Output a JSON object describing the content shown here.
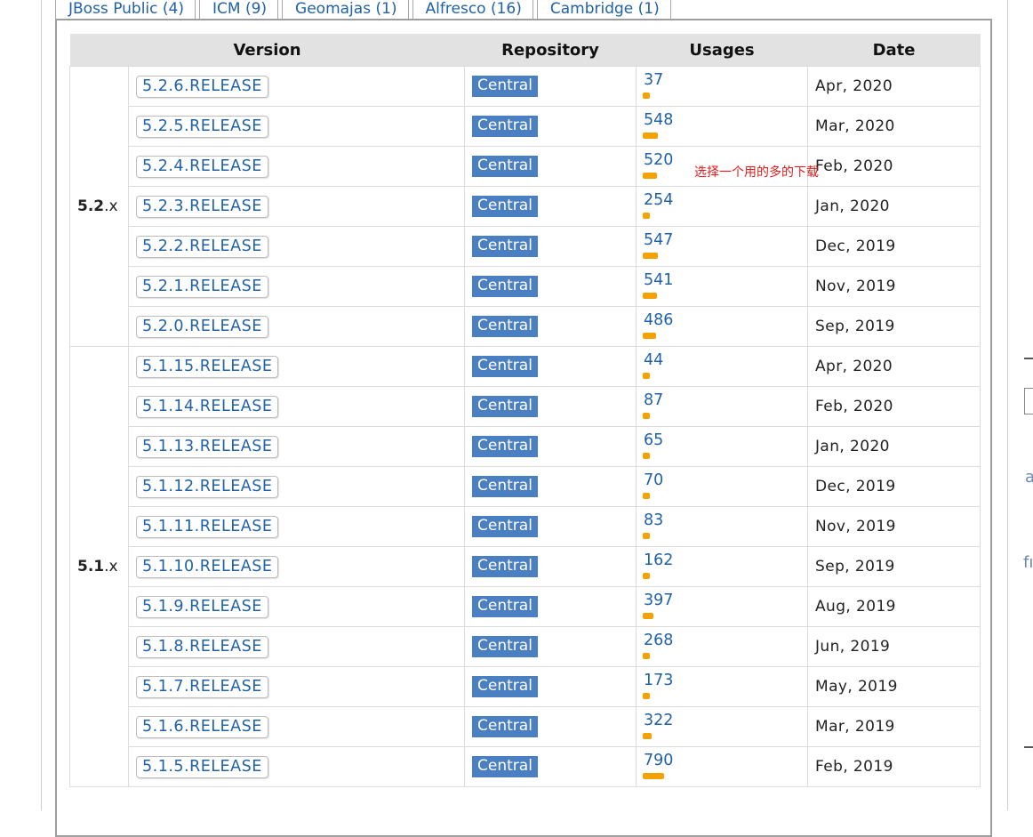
{
  "tabs": [
    "JBoss Public (4)",
    "ICM (9)",
    "Geomajas (1)",
    "Alfresco (16)",
    "Cambridge (1)"
  ],
  "table": {
    "headers": [
      "Version",
      "Repository",
      "Usages",
      "Date"
    ],
    "groups": [
      {
        "major": "5.2",
        "suffix": ".x",
        "rows": [
          {
            "version": "5.2.6.RELEASE",
            "repo": "Central",
            "usages": "37",
            "date": "Apr, 2020"
          },
          {
            "version": "5.2.5.RELEASE",
            "repo": "Central",
            "usages": "548",
            "date": "Mar, 2020"
          },
          {
            "version": "5.2.4.RELEASE",
            "repo": "Central",
            "usages": "520",
            "date": "Feb, 2020"
          },
          {
            "version": "5.2.3.RELEASE",
            "repo": "Central",
            "usages": "254",
            "date": "Jan, 2020"
          },
          {
            "version": "5.2.2.RELEASE",
            "repo": "Central",
            "usages": "547",
            "date": "Dec, 2019"
          },
          {
            "version": "5.2.1.RELEASE",
            "repo": "Central",
            "usages": "541",
            "date": "Nov, 2019"
          },
          {
            "version": "5.2.0.RELEASE",
            "repo": "Central",
            "usages": "486",
            "date": "Sep, 2019"
          }
        ]
      },
      {
        "major": "5.1",
        "suffix": ".x",
        "rows": [
          {
            "version": "5.1.15.RELEASE",
            "repo": "Central",
            "usages": "44",
            "date": "Apr, 2020"
          },
          {
            "version": "5.1.14.RELEASE",
            "repo": "Central",
            "usages": "87",
            "date": "Feb, 2020"
          },
          {
            "version": "5.1.13.RELEASE",
            "repo": "Central",
            "usages": "65",
            "date": "Jan, 2020"
          },
          {
            "version": "5.1.12.RELEASE",
            "repo": "Central",
            "usages": "70",
            "date": "Dec, 2019"
          },
          {
            "version": "5.1.11.RELEASE",
            "repo": "Central",
            "usages": "83",
            "date": "Nov, 2019"
          },
          {
            "version": "5.1.10.RELEASE",
            "repo": "Central",
            "usages": "162",
            "date": "Sep, 2019"
          },
          {
            "version": "5.1.9.RELEASE",
            "repo": "Central",
            "usages": "397",
            "date": "Aug, 2019"
          },
          {
            "version": "5.1.8.RELEASE",
            "repo": "Central",
            "usages": "268",
            "date": "Jun, 2019"
          },
          {
            "version": "5.1.7.RELEASE",
            "repo": "Central",
            "usages": "173",
            "date": "May, 2019"
          },
          {
            "version": "5.1.6.RELEASE",
            "repo": "Central",
            "usages": "322",
            "date": "Mar, 2019"
          },
          {
            "version": "5.1.5.RELEASE",
            "repo": "Central",
            "usages": "790",
            "date": "Feb, 2019"
          }
        ]
      }
    ]
  },
  "annotation": "选择一个用的多的下载",
  "side_fragments": [
    "a",
    "fı"
  ],
  "colors": {
    "link": "#2061a8",
    "repo_badge": "#4a7fc1",
    "usage_bar": "#f5a100",
    "annotation": "#e11b1b"
  }
}
